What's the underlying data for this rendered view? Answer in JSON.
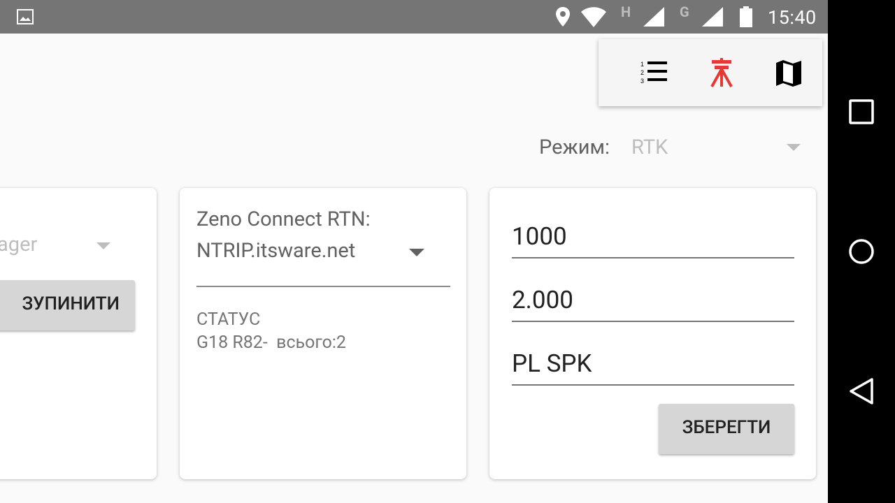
{
  "status_bar": {
    "time": "15:40",
    "network_letter_1": "H",
    "network_letter_2": "G"
  },
  "toolbar": {
    "icons": [
      "numbered-list-icon",
      "tripod-icon",
      "map-icon"
    ],
    "active_color": "#e53935"
  },
  "mode": {
    "label": "Режим:",
    "value": "RTK"
  },
  "card1": {
    "select_value": "nager",
    "button_label": "ЗУПИНИТИ"
  },
  "card2": {
    "source_label": "Zeno Connect RTN:",
    "source_value": "NTRIP.itsware.net",
    "status_label": "СТАТУС",
    "status_value": "G18 R82-  всього:2"
  },
  "card3": {
    "field1": "1000",
    "field2": "2.000",
    "field3": "PL SPK",
    "button_label": "ЗБЕРЕГТИ"
  },
  "nav": {
    "icons": [
      "recent-apps-icon",
      "home-icon",
      "back-icon"
    ]
  }
}
